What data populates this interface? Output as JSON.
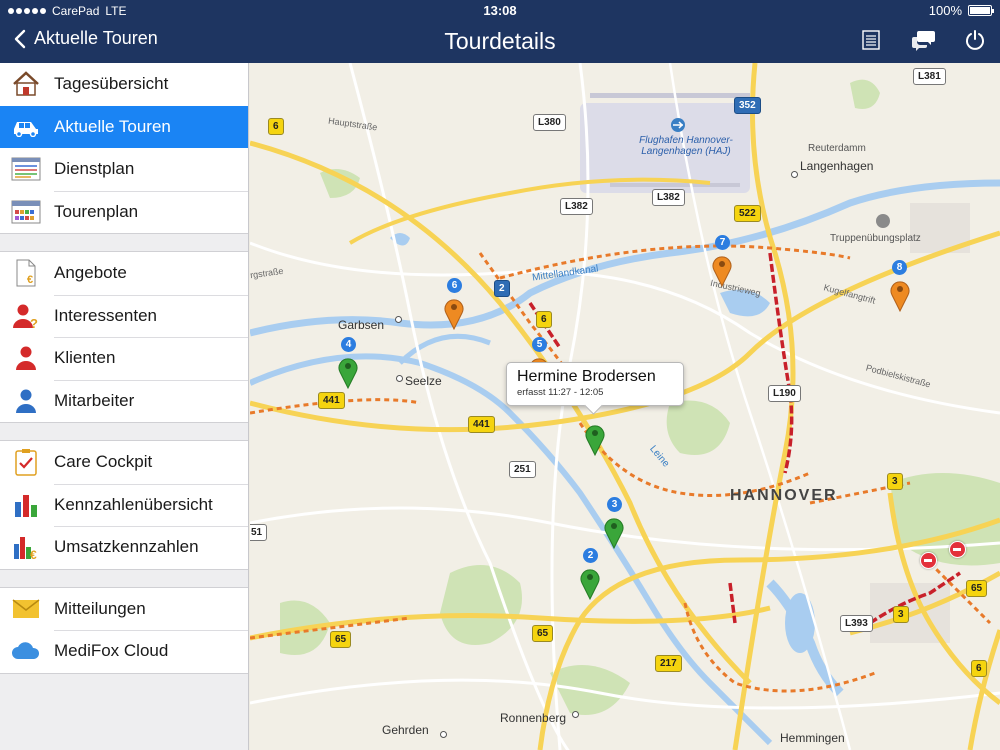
{
  "status_bar": {
    "carrier": "CarePad",
    "network": "LTE",
    "time": "13:08",
    "battery": "100%",
    "battery_level": 1.0
  },
  "nav": {
    "back_label": "Aktuelle Touren",
    "title": "Tourdetails",
    "icons": [
      "list-icon",
      "chat-bubbles-icon",
      "power-icon"
    ]
  },
  "sidebar": {
    "groups": [
      [
        {
          "label": "Tagesübersicht",
          "icon": "house-icon"
        },
        {
          "label": "Aktuelle Touren",
          "icon": "car-icon",
          "active": true
        },
        {
          "label": "Dienstplan",
          "icon": "schedule-list-icon"
        },
        {
          "label": "Tourenplan",
          "icon": "tour-calendar-icon"
        }
      ],
      [
        {
          "label": "Angebote",
          "icon": "euro-document-icon"
        },
        {
          "label": "Interessenten",
          "icon": "person-question-icon"
        },
        {
          "label": "Klienten",
          "icon": "person-red-icon"
        },
        {
          "label": "Mitarbeiter",
          "icon": "person-blue-icon"
        }
      ],
      [
        {
          "label": "Care Cockpit",
          "icon": "clipboard-check-icon"
        },
        {
          "label": "Kennzahlenübersicht",
          "icon": "bar-chart-icon"
        },
        {
          "label": "Umsatzkennzahlen",
          "icon": "euro-bar-chart-icon"
        }
      ],
      [
        {
          "label": "Mitteilungen",
          "icon": "envelope-icon"
        },
        {
          "label": "MediFox Cloud",
          "icon": "cloud-icon"
        }
      ]
    ]
  },
  "map": {
    "places": {
      "hannover": "HANNOVER",
      "garbsen": "Garbsen",
      "seelze": "Seelze",
      "langenhagen": "Langenhagen",
      "reuterdamm": "Reuterdamm",
      "truppen": "Truppenübungsplatz",
      "ronnenberg": "Ronnenberg",
      "gehrden": "Gehrden",
      "hemmingen": "Hemmingen",
      "hauptstrasse": "Hauptstraße",
      "rgstrasse": "rgstraße",
      "industrieweg": "Industrieweg",
      "kugelfangtrift": "Kugelfangtrift",
      "podbielski": "Podbielskistraße",
      "mittellandkanal": "Mittellandkanal",
      "leine": "Leine",
      "airport": "Flughafen Hannover-Langenhagen (HAJ)"
    },
    "shields": {
      "s6a": "6",
      "s352": "352",
      "l381": "L381",
      "l380": "L380",
      "l382a": "L382",
      "l382b": "L382",
      "s522": "522",
      "s2": "2",
      "s6b": "6",
      "s441a": "441",
      "s441b": "441",
      "s251": "251",
      "l190": "L190",
      "s3a": "3",
      "s65a": "65",
      "s3b": "3",
      "l393": "L393",
      "s65b": "65",
      "s65c": "65",
      "s217": "217",
      "s6c": "6",
      "s51": "51"
    },
    "pins": [
      {
        "num": "2",
        "color": "green"
      },
      {
        "num": "3",
        "color": "green"
      },
      {
        "num": "4",
        "color": "green"
      },
      {
        "num": "5",
        "color": "orange"
      },
      {
        "num": "6",
        "color": "orange"
      },
      {
        "num": "7",
        "color": "orange"
      },
      {
        "num": "8",
        "color": "orange"
      }
    ],
    "callout": {
      "name": "Hermine Brodersen",
      "time": "erfasst 11:27 - 12:05"
    }
  },
  "colors": {
    "nav_bg": "#1e3561",
    "active_item": "#1a84f4",
    "pin_green": "#3aa63a",
    "pin_orange": "#ee8a22",
    "pin_badge": "#2c7de0"
  }
}
